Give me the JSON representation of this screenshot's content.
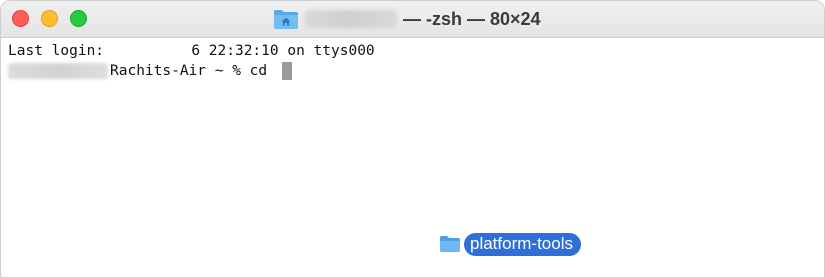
{
  "window": {
    "title": "— -zsh — 80×24",
    "title_icon": "home-folder-icon",
    "traffic_lights": [
      "close-button",
      "minimize-button",
      "zoom-button"
    ]
  },
  "terminal": {
    "line1": "Last login:          6 22:32:10 on ttys000",
    "line2_prompt": "Rachits-Air ~ % cd ",
    "cursor": "block-cursor"
  },
  "drag": {
    "label": "platform-tools",
    "icon": "folder-icon",
    "highlight_color": "#2e6fd9"
  },
  "colors": {
    "close": "#ff5f57",
    "minimize": "#febc2e",
    "zoom": "#28c840"
  }
}
